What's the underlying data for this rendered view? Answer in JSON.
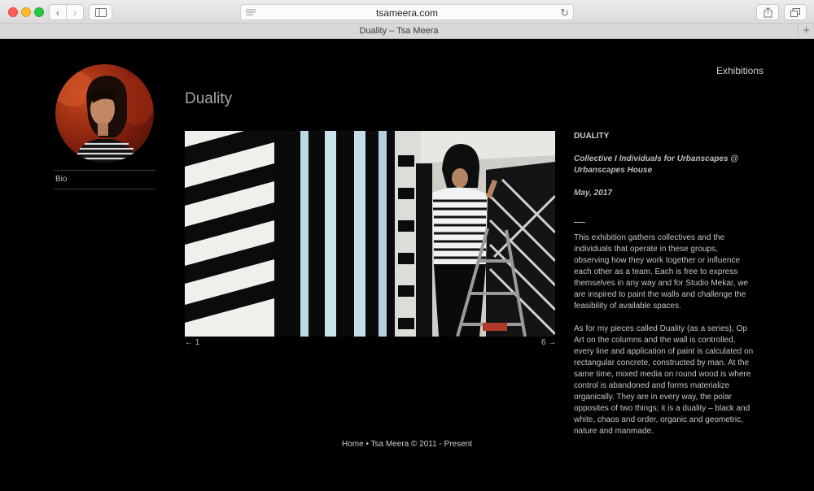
{
  "browser": {
    "url": "tsameera.com",
    "tab_title": "Duality – Tsa Meera",
    "back_icon": "chevron-left-icon",
    "forward_icon": "chevron-right-icon",
    "reload_icon": "reload-icon",
    "new_tab_symbol": "+"
  },
  "sidebar": {
    "bio_label": "Bio"
  },
  "nav": {
    "exhibitions_label": "Exhibitions"
  },
  "main": {
    "title": "Duality",
    "prev_label": "← 1",
    "next_label": "6 →"
  },
  "info": {
    "heading": "DUALITY",
    "subtitle": "Collective I Individuals for Urbanscapes @ Urbanscapes House",
    "date": "May, 2017",
    "paragraph1": "This exhibition gathers collectives and the individuals that operate in these groups, observing how they work together or influence each other as a team. Each is free to express themselves in any way and for Studio Mekar, we are inspired to paint the walls and challenge the feasibility of available spaces.",
    "paragraph2": "As for my pieces called Duality (as a series), Op Art on the columns and the wall is controlled, every line and application of paint is calculated on rectangular concrete, constructed by man. At the same time, mixed media on round wood is where control is abandoned and forms materialize organically. They are in every way, the polar opposites of two things; it is a duality – black and white, chaos and order, organic and geometric, nature and manmade."
  },
  "footer": {
    "text": "Home • Tsa Meera © 2011 - Present"
  },
  "colors": {
    "page_background": "#000000",
    "text": "#c6c6c6",
    "title": "#a6a6a6"
  }
}
